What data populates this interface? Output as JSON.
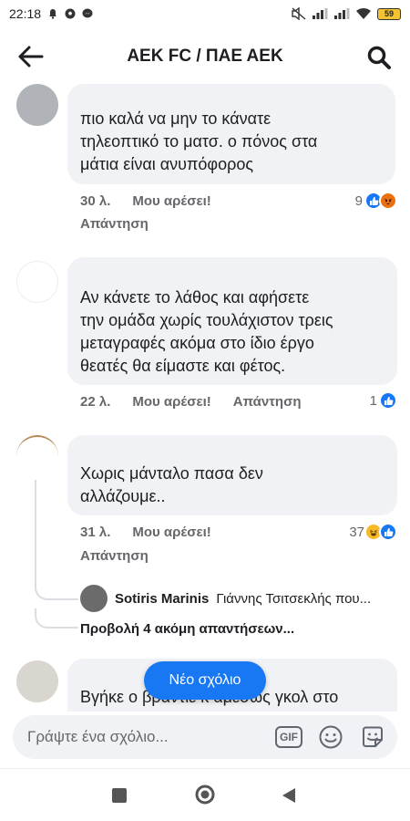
{
  "status_bar": {
    "time": "22:18",
    "battery": "59"
  },
  "header": {
    "title": "AEK FC / ΠΑΕ ΑΕΚ",
    "back_icon": "arrow-left-icon",
    "search_icon": "search-icon"
  },
  "comments": [
    {
      "lines": [
        "πιο καλά να μην το κάνατε",
        "τηλεοπτικό το ματσ. ο πόνος στα",
        "μάτια είναι ανυπόφορος"
      ],
      "time": "30 λ.",
      "like_label": "Μου αρέσει!",
      "reply_label": "Απάντηση",
      "reaction_count": "9",
      "reactions": [
        "like",
        "angry"
      ]
    },
    {
      "lines": [
        "Αν κάνετε  το λάθος και αφήσετε",
        "την ομάδα χωρίς τουλάχιστον τρεις",
        "μεταγραφές ακόμα στο ίδιο έργο",
        "θεατές θα είμαστε και φέτος."
      ],
      "time": "22 λ.",
      "like_label": "Μου αρέσει!",
      "reply_label": "Απάντηση",
      "reaction_count": "1",
      "reactions": [
        "like"
      ]
    },
    {
      "lines": [
        "Χωρις μάνταλο πασα δεν",
        "αλλάζουμε.."
      ],
      "time": "31 λ.",
      "like_label": "Μου αρέσει!",
      "reply_label": "Απάντηση",
      "reaction_count": "37",
      "reactions": [
        "haha",
        "like"
      ]
    },
    {
      "lines": [
        "Βγήκε ο βραντιε κ αμεσως γκολ στο"
      ]
    }
  ],
  "reply_preview": {
    "author": "Sotiris Marinis",
    "text": "Γιάννης Τσιτσεκλής που...",
    "view_more": "Προβολή 4 ακόμη απαντήσεων..."
  },
  "new_comment_pill": "Νέο σχόλιο",
  "composer": {
    "placeholder": "Γράψτε ένα σχόλιο...",
    "gif_label": "GIF"
  },
  "colors": {
    "accent": "#1877f2",
    "bubble": "#f0f2f5",
    "secondary_text": "#65676b"
  }
}
